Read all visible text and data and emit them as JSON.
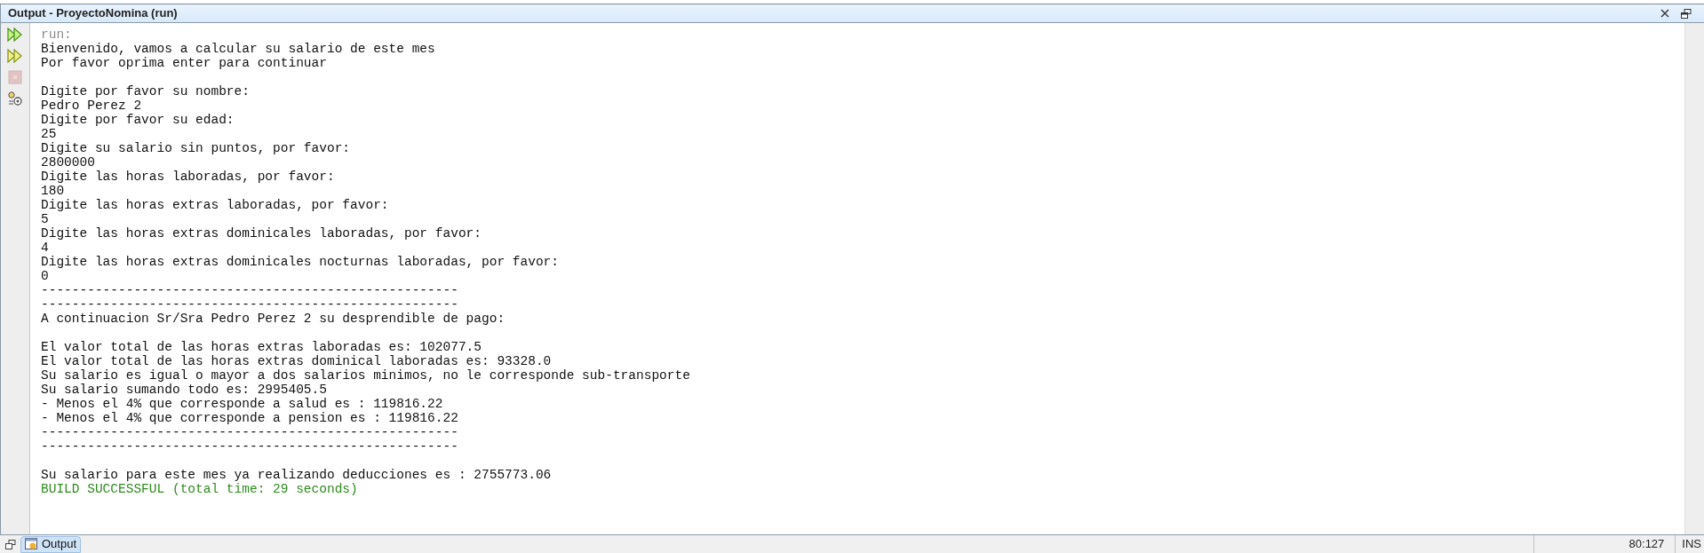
{
  "window": {
    "title": "Output - ProyectoNomina (run)"
  },
  "toolbar": [
    {
      "kind": "rerun",
      "disabled": false
    },
    {
      "kind": "rerun-options",
      "disabled": false
    },
    {
      "kind": "stop",
      "disabled": true
    },
    {
      "kind": "settings",
      "disabled": false
    }
  ],
  "lines": [
    {
      "kind": "dim",
      "text": "run:"
    },
    {
      "kind": "normal",
      "text": "Bienvenido, vamos a calcular su salario de este mes"
    },
    {
      "kind": "normal",
      "text": "Por favor oprima enter para continuar"
    },
    {
      "kind": "blank"
    },
    {
      "kind": "normal",
      "text": "Digite por favor su nombre:"
    },
    {
      "kind": "normal",
      "text": "Pedro Perez 2"
    },
    {
      "kind": "normal",
      "text": "Digite por favor su edad:"
    },
    {
      "kind": "normal",
      "text": "25"
    },
    {
      "kind": "normal",
      "text": "Digite su salario sin puntos, por favor:"
    },
    {
      "kind": "normal",
      "text": "2800000"
    },
    {
      "kind": "normal",
      "text": "Digite las horas laboradas, por favor:"
    },
    {
      "kind": "normal",
      "text": "180"
    },
    {
      "kind": "normal",
      "text": "Digite las horas extras laboradas, por favor:"
    },
    {
      "kind": "normal",
      "text": "5"
    },
    {
      "kind": "normal",
      "text": "Digite las horas extras dominicales laboradas, por favor:"
    },
    {
      "kind": "normal",
      "text": "4"
    },
    {
      "kind": "normal",
      "text": "Digite las horas extras dominicales nocturnas laboradas, por favor:"
    },
    {
      "kind": "normal",
      "text": "0"
    },
    {
      "kind": "normal",
      "text": "------------------------------------------------------"
    },
    {
      "kind": "normal",
      "text": "------------------------------------------------------"
    },
    {
      "kind": "normal",
      "text": "A continuacion Sr/Sra Pedro Perez 2 su desprendible de pago:"
    },
    {
      "kind": "blank"
    },
    {
      "kind": "normal",
      "text": "El valor total de las horas extras laboradas es: 102077.5"
    },
    {
      "kind": "normal",
      "text": "El valor total de las horas extras dominical laboradas es: 93328.0"
    },
    {
      "kind": "normal",
      "text": "Su salario es igual o mayor a dos salarios minimos, no le corresponde sub-transporte"
    },
    {
      "kind": "normal",
      "text": "Su salario sumando todo es: 2995405.5"
    },
    {
      "kind": "normal",
      "text": "- Menos el 4% que corresponde a salud es : 119816.22"
    },
    {
      "kind": "normal",
      "text": "- Menos el 4% que corresponde a pension es : 119816.22"
    },
    {
      "kind": "normal",
      "text": "------------------------------------------------------"
    },
    {
      "kind": "normal",
      "text": "------------------------------------------------------"
    },
    {
      "kind": "blank"
    },
    {
      "kind": "normal",
      "text": "Su salario para este mes ya realizando deducciones es : 2755773.06"
    },
    {
      "kind": "success",
      "text": "BUILD SUCCESSFUL (total time: 29 seconds)"
    }
  ],
  "bottom_tabs": [
    {
      "label": "Output",
      "selected": true
    }
  ],
  "status_bar": {
    "position": "80:127",
    "mode": "INS"
  }
}
